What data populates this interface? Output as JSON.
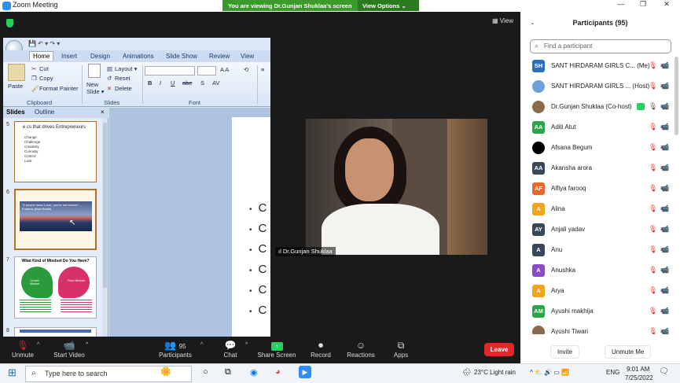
{
  "window": {
    "title": "Zoom Meeting",
    "min": "—",
    "max": "❐",
    "close": "✕"
  },
  "banner": {
    "message": "You are viewing Dr.Gunjan Shuklaa's screen",
    "view_options": "View Options ⌄"
  },
  "view_button": "▦ View",
  "ppt": {
    "qat": "💾 ↶ ▾ ↷ ▾",
    "tabs": [
      "Home",
      "Insert",
      "Design",
      "Animations",
      "Slide Show",
      "Review",
      "View"
    ],
    "clipboard": {
      "paste": "Paste",
      "cut": "Cut",
      "copy": "Copy",
      "format_painter": "Format Painter",
      "label": "Clipboard"
    },
    "slides": {
      "new_slide": "New Slide ▾",
      "layout": "Layout ▾",
      "reset": "Reset",
      "delete": "Delete",
      "label": "Slides"
    },
    "font": {
      "label": "Font",
      "buttons": [
        "B",
        "I",
        "U",
        "abe",
        "S",
        "AV"
      ]
    },
    "pane_tabs": [
      "Slides",
      "Outline"
    ],
    "pane_close": "×",
    "thumb5": {
      "num": "5",
      "title": "e cs that drives Entrepreneurs",
      "items": [
        "Change",
        "Challenge",
        "Creativity",
        "Curiosity",
        "Control",
        "Luck"
      ]
    },
    "thumb6": {
      "num": "6",
      "text": "\"If people have 'Luck', you're not learner\" – Frederic (Bus Model)"
    },
    "thumb7": {
      "num": "7",
      "title": "What Kind of Mindset Do You Have?",
      "left": "Growth Mindset",
      "right": "Fixed Mindset"
    },
    "thumb8": {
      "num": "8"
    },
    "bullets": [
      "C",
      "C",
      "C",
      "C",
      "C",
      "C"
    ]
  },
  "video": {
    "name": "Dr.Gunjan Shuklaa",
    "signal_icon": "ıl"
  },
  "toolbar": {
    "unmute": "Unmute",
    "start_video": "Start Video",
    "participants": "Participants",
    "participants_count": "95",
    "chat": "Chat",
    "share_screen": "Share Screen",
    "record": "Record",
    "reactions": "Reactions",
    "apps": "Apps",
    "leave": "Leave",
    "share_color": "#23d160",
    "leave_color": "#e02828"
  },
  "panel": {
    "title": "Participants (95)",
    "search_placeholder": "Find a participant",
    "participants": [
      {
        "initials": "SH",
        "name": "SANT HIRDARAM GIRLS C... (Me)",
        "color": "#2d6fb8"
      },
      {
        "initials": "",
        "name": "SANT HIRDARAM GIRLS ... (Host)",
        "color": "#6ca0d8"
      },
      {
        "initials": "",
        "name": "Dr.Gunjan Shuklaa (Co-host)",
        "color": "#8a6a4a"
      },
      {
        "initials": "AA",
        "name": "Aditi Atut",
        "color": "#2aa64a"
      },
      {
        "initials": "",
        "name": "Afsana Begum",
        "color": "#000000"
      },
      {
        "initials": "AA",
        "name": "Akansha arora",
        "color": "#38475a"
      },
      {
        "initials": "AF",
        "name": "Alfiya farooq",
        "color": "#e8682a"
      },
      {
        "initials": "A",
        "name": "Alina",
        "color": "#f0a51a"
      },
      {
        "initials": "AY",
        "name": "Anjali yadav",
        "color": "#38475a"
      },
      {
        "initials": "A",
        "name": "Anu",
        "color": "#38475a"
      },
      {
        "initials": "A",
        "name": "Anushka",
        "color": "#8a4ac8"
      },
      {
        "initials": "A",
        "name": "Arya",
        "color": "#f0a51a"
      },
      {
        "initials": "AM",
        "name": "Ayushi makhija",
        "color": "#2aa64a"
      },
      {
        "initials": "",
        "name": "Ayushi Tiwari",
        "color": "#8a6a4a"
      }
    ],
    "invite": "Invite",
    "unmute_me": "Unmute Me"
  },
  "taskbar": {
    "search_placeholder": "Type here to search",
    "weather": "23°C Light rain",
    "lang": "ENG",
    "time": "9:01 AM",
    "date": "7/25/2022"
  }
}
